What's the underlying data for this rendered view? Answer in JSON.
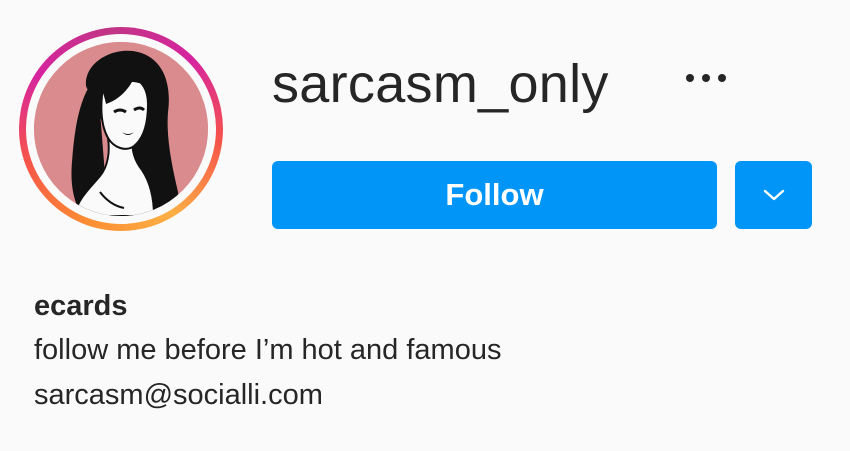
{
  "profile": {
    "username": "sarcasm_only",
    "avatar_icon": "portrait-illustration",
    "ring_colors": [
      "#fdb045",
      "#f6544a",
      "#d6249f"
    ]
  },
  "actions": {
    "follow_label": "Follow",
    "more_icon": "ellipsis-icon",
    "dropdown_icon": "chevron-down-icon",
    "button_color": "#0095f6"
  },
  "bio": {
    "name": "ecards",
    "text": "follow me before I’m hot and famous",
    "email": "sarcasm@socialli.com"
  }
}
